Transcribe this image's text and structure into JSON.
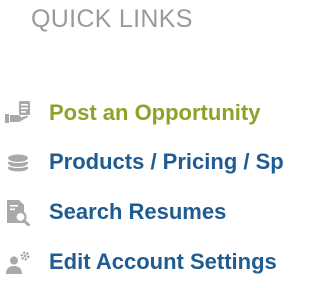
{
  "heading": "QUICK LINKS",
  "colors": {
    "heading": "#9a9a9a",
    "primary_link": "#8aa328",
    "link": "#1f5c91",
    "icon": "#a9a9a9"
  },
  "links": [
    {
      "label": "Post an Opportunity",
      "icon": "hand-document-icon"
    },
    {
      "label": "Products / Pricing / Sp",
      "icon": "coin-stack-icon"
    },
    {
      "label": "Search Resumes",
      "icon": "document-search-icon"
    },
    {
      "label": "Edit Account Settings",
      "icon": "user-gear-icon"
    }
  ]
}
